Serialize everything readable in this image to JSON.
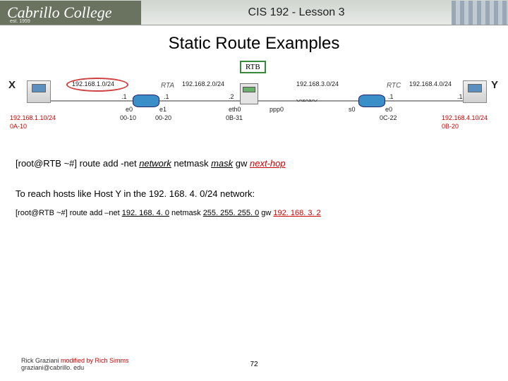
{
  "header": {
    "logo_text": "Cabrillo College",
    "logo_est": "est. 1959",
    "course_title": "CIS 192 - Lesson 3"
  },
  "slide": {
    "title": "Static Route Examples"
  },
  "diagram": {
    "rtb_label": "RTB",
    "host_x": "X",
    "host_y": "Y",
    "rta": "RTA",
    "rtc": "RTC",
    "net1": "192.168.1.0/24",
    "net2": "192.168.2.0/24",
    "net3": "192.168.3.0/24",
    "net4": "192.168.4.0/24",
    "dot1_a": ".1",
    "dot1_b": ".1",
    "dot1_c": ".1",
    "dot1_d": ".1",
    "dot2": ".2",
    "e0_a": "e0",
    "e1": "e1",
    "e0_b": "e0",
    "s0": "s0",
    "eth0": "eth0",
    "ppp0": "ppp0",
    "ip_x": "192.168.1.10/24",
    "mac_x": "0A-10",
    "mac_00_10": "00-10",
    "mac_00_20": "00-20",
    "mac_0b_31": "0B-31",
    "mac_0c_22": "0C-22",
    "ip_y": "192.168.4.10/24",
    "mac_y": "0B-20"
  },
  "command1": {
    "prompt": "[root@RTB ~#] ",
    "cmd": "route add -net ",
    "arg_network": "network",
    "kw_netmask": " netmask ",
    "arg_mask": "mask",
    "kw_gw": " gw ",
    "arg_nexthop": "next-hop"
  },
  "explain": {
    "text": "To reach hosts like Host Y in the 192. 168. 4. 0/24 network:"
  },
  "command2": {
    "prompt": "[root@RTB ~#] ",
    "cmd": "route add –net ",
    "net": "192. 168. 4. 0",
    "kw_netmask": " netmask ",
    "mask": "255. 255. 255. 0",
    "kw_gw": " gw ",
    "gw": "192. 168. 3. 2"
  },
  "footer": {
    "author": "Rick Graziani",
    "modified": "  modified by Rich Simms",
    "email": "graziani@cabrillo. edu"
  },
  "page": "72"
}
